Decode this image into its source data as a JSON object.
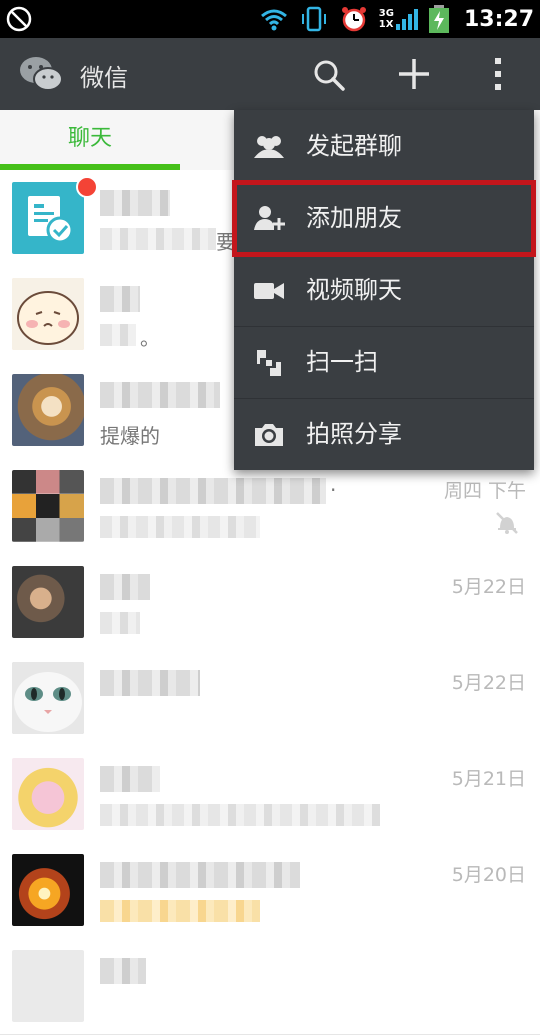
{
  "status_bar": {
    "time": "13:27",
    "signal_labels": [
      "3G",
      "1X"
    ]
  },
  "app_bar": {
    "title": "微信",
    "icons": [
      "wechat-logo",
      "search-icon",
      "plus-icon",
      "more-icon"
    ]
  },
  "tabs": [
    {
      "label": "聊天",
      "active": true
    }
  ],
  "menu": {
    "items": [
      {
        "label": "发起群聊",
        "icon": "group-icon"
      },
      {
        "label": "添加朋友",
        "icon": "add-friend-icon",
        "highlighted": true
      },
      {
        "label": "视频聊天",
        "icon": "video-icon"
      },
      {
        "label": "扫一扫",
        "icon": "scan-icon"
      },
      {
        "label": "拍照分享",
        "icon": "camera-icon"
      }
    ]
  },
  "chats": [
    {
      "time": "",
      "snippet_suffix": "要",
      "unread_dot": true
    },
    {
      "time": "",
      "snippet_suffix": "。"
    },
    {
      "time": "",
      "snippet": "提爆的"
    },
    {
      "time": "周四 下午",
      "snippet_suffix": ".",
      "muted": true
    },
    {
      "time": "5月22日"
    },
    {
      "time": "5月22日"
    },
    {
      "time": "5月21日"
    },
    {
      "time": "5月20日"
    }
  ],
  "colors": {
    "accent": "#45c01a",
    "bar_dark": "#3a3e42",
    "highlight_border": "#c4161c",
    "badge": "#f44336"
  }
}
